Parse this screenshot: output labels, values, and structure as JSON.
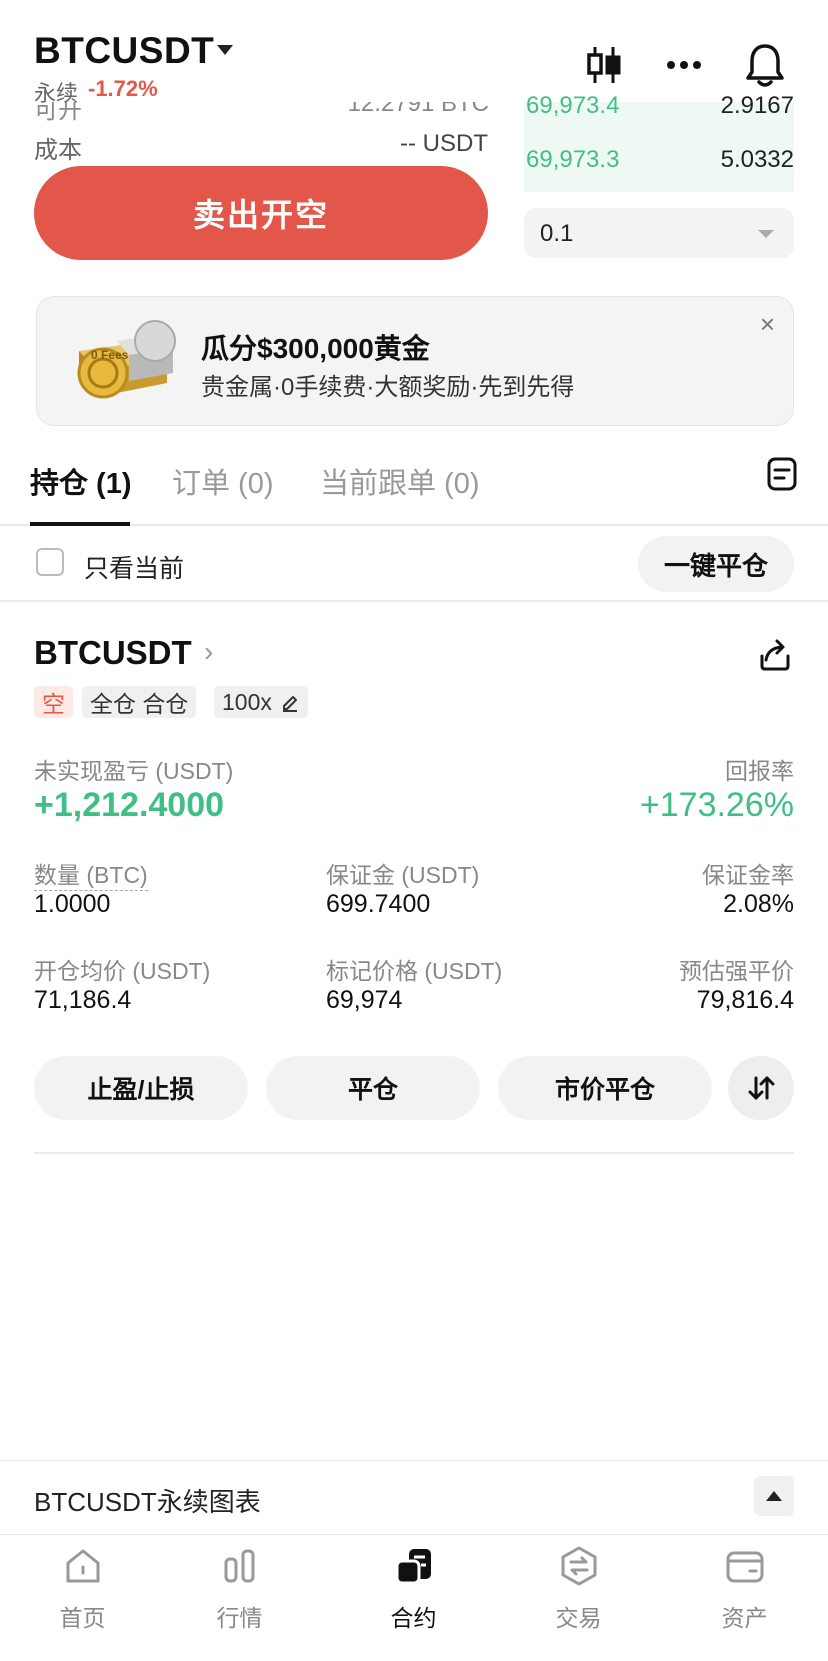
{
  "header": {
    "symbol": "BTCUSDT",
    "subtitle": "永续",
    "change": "-1.72%"
  },
  "order_form": {
    "cut_row_left": "可开",
    "cut_row_right": "12.2791 BTC",
    "cost_label": "成本",
    "cost_value": "-- USDT",
    "sell_button": "卖出开空",
    "order_book": [
      {
        "price": "69,973.4",
        "qty": "2.9167"
      },
      {
        "price": "69,973.3",
        "qty": "5.0332"
      }
    ],
    "depth_value": "0.1"
  },
  "banner": {
    "title": "瓜分$300,000黄金",
    "subtitle": "贵金属·0手续费·大额奖励·先到先得",
    "close": "×",
    "gold_text": "0 Fees"
  },
  "tabs": [
    {
      "label": "持仓 (1)",
      "active": true
    },
    {
      "label": "订单 (0)",
      "active": false
    },
    {
      "label": "当前跟单 (0)",
      "active": false
    }
  ],
  "filter": {
    "only_current": "只看当前",
    "close_all": "一键平仓"
  },
  "position": {
    "symbol": "BTCUSDT",
    "chevron": "›",
    "side_tag": "空",
    "mode_tag": "全仓 合仓",
    "leverage_tag": "100x",
    "pnl_label": "未实现盈亏 (USDT)",
    "pnl_value": "+1,212.4000",
    "roe_label": "回报率",
    "roe_value": "+173.26%",
    "qty_label": "数量 (BTC)",
    "qty_value": "1.0000",
    "margin_label": "保证金 (USDT)",
    "margin_value": "699.7400",
    "margin_ratio_label": "保证金率",
    "margin_ratio_value": "2.08%",
    "entry_label": "开仓均价 (USDT)",
    "entry_value": "71,186.4",
    "mark_label": "标记价格 (USDT)",
    "mark_value": "69,974",
    "liq_label": "预估强平价",
    "liq_value": "79,816.4",
    "actions": {
      "tp_sl": "止盈/止损",
      "close": "平仓",
      "market_close": "市价平仓"
    }
  },
  "chart_bar": {
    "label": "BTCUSDT永续图表"
  },
  "nav": [
    {
      "label": "首页",
      "icon": "home-icon",
      "active": false
    },
    {
      "label": "行情",
      "icon": "markets-icon",
      "active": false
    },
    {
      "label": "合约",
      "icon": "futures-icon",
      "active": true
    },
    {
      "label": "交易",
      "icon": "trade-icon",
      "active": false
    },
    {
      "label": "资产",
      "icon": "wallet-icon",
      "active": false
    }
  ],
  "colors": {
    "sell": "#e2574a",
    "up": "#3fbf86",
    "down": "#e05a47"
  }
}
